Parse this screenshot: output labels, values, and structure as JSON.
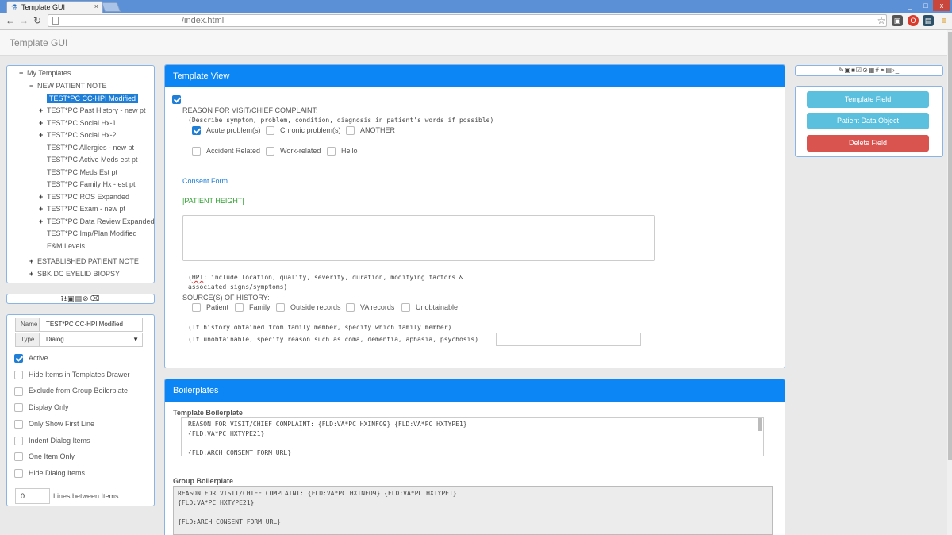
{
  "browser": {
    "tab_title": "Template GUI",
    "tab_close": "×",
    "url": "/index.html",
    "win_min": "_",
    "win_max": "□",
    "win_close": "x",
    "ext_icons": [
      "star-icon",
      "extension-icon",
      "opera-icon",
      "extension-icon",
      "menu-icon"
    ]
  },
  "app": {
    "title": "Template GUI"
  },
  "tree": {
    "root": "My Templates",
    "items": [
      {
        "toggle": "−",
        "label": "NEW PATIENT NOTE"
      },
      {
        "toggle": "",
        "label": "TEST*PC CC-HPI Modified",
        "selected": true
      },
      {
        "toggle": "+",
        "label": "TEST*PC Past History - new pt"
      },
      {
        "toggle": "+",
        "label": "TEST*PC Social Hx-1"
      },
      {
        "toggle": "+",
        "label": "TEST*PC Social Hx-2"
      },
      {
        "toggle": "",
        "label": "TEST*PC Allergies - new pt"
      },
      {
        "toggle": "",
        "label": "TEST*PC Active Meds est pt"
      },
      {
        "toggle": "",
        "label": "TEST*PC Meds Est pt"
      },
      {
        "toggle": "",
        "label": "TEST*PC Family Hx - est pt"
      },
      {
        "toggle": "+",
        "label": "TEST*PC ROS Expanded"
      },
      {
        "toggle": "+",
        "label": "TEST*PC Exam - new pt"
      },
      {
        "toggle": "+",
        "label": "TEST*PC Data Review Expanded"
      },
      {
        "toggle": "",
        "label": "TEST*PC Imp/Plan Modified"
      },
      {
        "toggle": "",
        "label": "E&M Levels"
      },
      {
        "toggle": "+",
        "label": "ESTABLISHED PATIENT NOTE"
      },
      {
        "toggle": "+",
        "label": "SBK DC EYELID BIOPSY"
      }
    ],
    "root_toggle": "−",
    "toolbar_glyphs": "⭱⭳▣▤⊘🗑"
  },
  "props": {
    "name_label": "Name",
    "name_value": "TEST*PC CC-HPI Modified",
    "type_label": "Type",
    "type_value": "Dialog",
    "type_caret": "▼",
    "checks": [
      {
        "label": "Active",
        "checked": true
      },
      {
        "label": "Hide Items in Templates Drawer",
        "checked": false
      },
      {
        "label": "Exclude from Group Boilerplate",
        "checked": false
      },
      {
        "label": "Display Only",
        "checked": false
      },
      {
        "label": "Only Show First Line",
        "checked": false
      },
      {
        "label": "Indent Dialog Items",
        "checked": false
      },
      {
        "label": "One Item Only",
        "checked": false
      },
      {
        "label": "Hide Dialog Items",
        "checked": false
      }
    ],
    "lines_value": "0",
    "lines_label": "Lines between Items"
  },
  "template_view": {
    "title": "Template View",
    "reason_title": "REASON FOR VISIT/CHIEF COMPLAINT:",
    "reason_desc": "(Describe symptom, problem, condition, diagnosis in patient's words if possible)",
    "row1": [
      {
        "label": "Acute problem(s)",
        "checked": true
      },
      {
        "label": "Chronic problem(s)",
        "checked": false
      },
      {
        "label": "ANOTHER",
        "checked": false
      }
    ],
    "row2": [
      {
        "label": "Accident Related",
        "checked": false
      },
      {
        "label": "Work-related",
        "checked": false
      },
      {
        "label": "Hello",
        "checked": false
      }
    ],
    "consent_link": "Consent Form",
    "patient_height": "|PATIENT HEIGHT|",
    "hpi_line1_a": "(",
    "hpi_line1_b": "HPI",
    "hpi_line1_c": ": include location, quality, severity, duration, modifying factors &",
    "hpi_line2": "associated signs/symptoms)",
    "source_title": "SOURCE(S) OF HISTORY:",
    "sources": [
      {
        "label": "Patient"
      },
      {
        "label": "Family"
      },
      {
        "label": "Outside records"
      },
      {
        "label": "VA records"
      },
      {
        "label": "Unobtainable"
      }
    ],
    "family_note": "(If history obtained from family member, specify which family member)",
    "unobtain_note": "(If unobtainable, specify reason such as coma, dementia, aphasia, psychosis)"
  },
  "boilerplates": {
    "title": "Boilerplates",
    "template_label": "Template Boilerplate",
    "template_lines": [
      "REASON FOR VISIT/CHIEF COMPLAINT:  {FLD:VA*PC HXINFO9} {FLD:VA*PC HXTYPE1}",
      "{FLD:VA*PC HXTYPE21}",
      "",
      "{FLD:ARCH CONSENT FORM URL}"
    ],
    "group_label": "Group Boilerplate",
    "group_lines": [
      " REASON FOR VISIT/CHIEF COMPLAINT:  {FLD:VA*PC HXINFO9} {FLD:VA*PC HXTYPE1}",
      "{FLD:VA*PC HXTYPE21}",
      "",
      "{FLD:ARCH CONSENT FORM URL}"
    ]
  },
  "right": {
    "icon_strip": "✎▣■☑⊙▦#⚭▤›_",
    "template_field": "Template Field",
    "patient_data_object": "Patient Data Object",
    "delete_field": "Delete Field"
  }
}
